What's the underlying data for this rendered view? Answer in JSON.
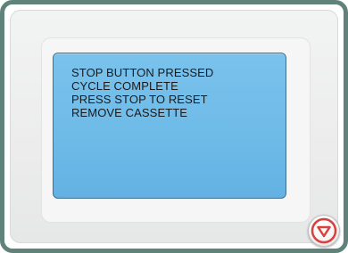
{
  "display": {
    "messages": [
      "STOP BUTTON PRESSED",
      "CYCLE COMPLETE",
      "PRESS STOP TO RESET",
      "REMOVE CASSETTE"
    ]
  },
  "stop_button": {
    "icon": "stop-triangle-icon",
    "color": "#d9413f"
  },
  "colors": {
    "frame": "#5f837a",
    "screen": "#6fbbe8",
    "screen_border": "#3f6f95"
  }
}
